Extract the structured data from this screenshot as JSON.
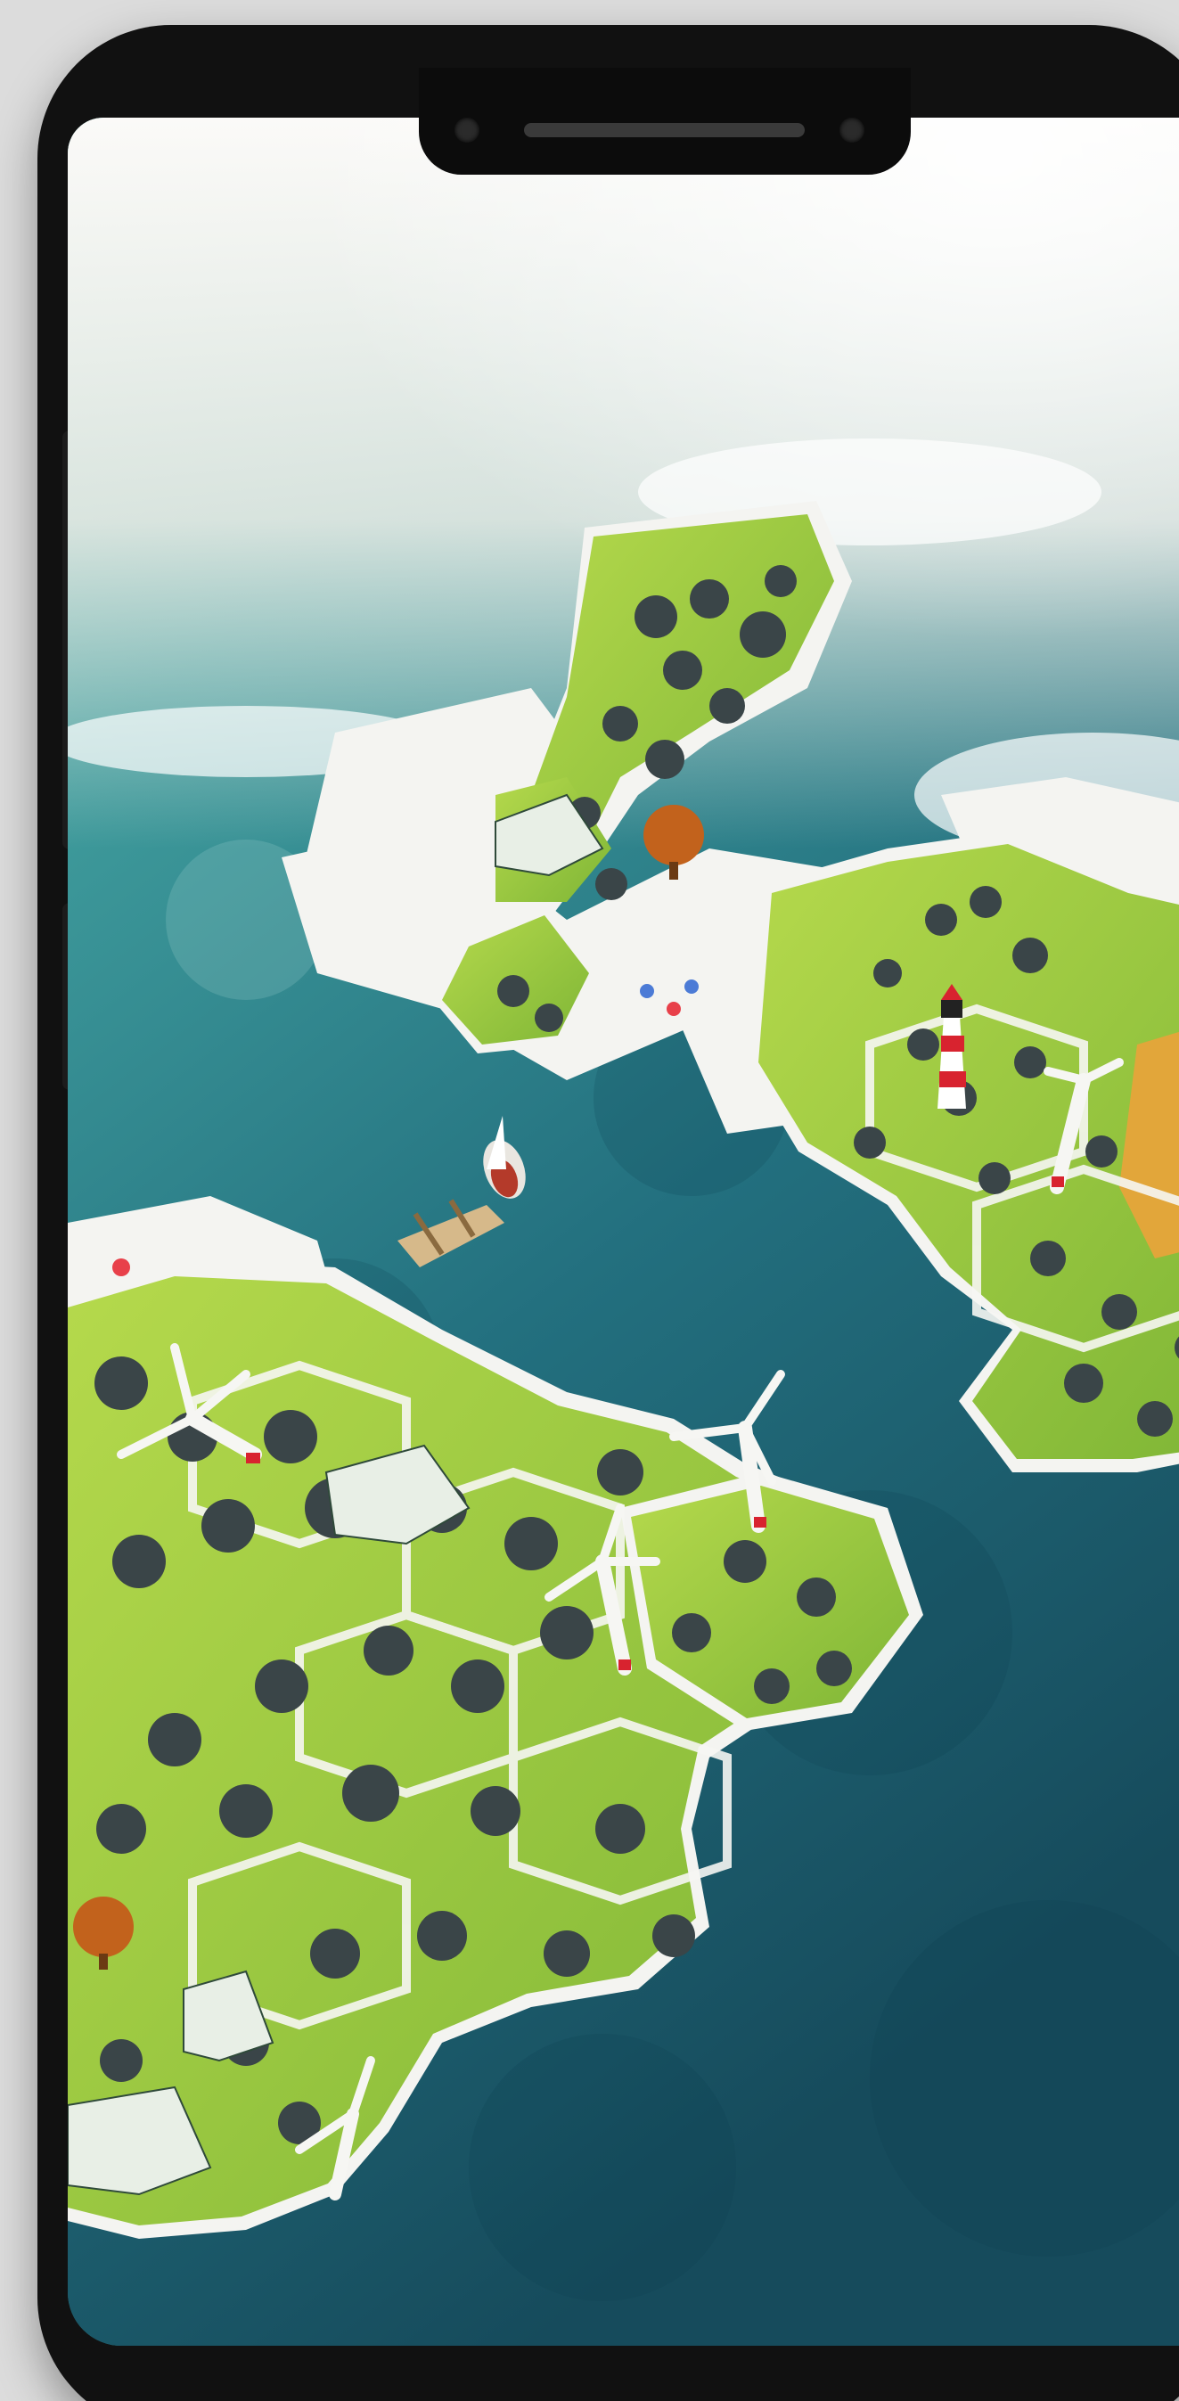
{
  "scene": {
    "description_items": [
      "island-map",
      "windmills",
      "lighthouse",
      "sailboat",
      "dock",
      "forest-tiles"
    ]
  },
  "colors": {
    "sea_deep": "#1c5a6a",
    "sea_mid": "#2f8a8f",
    "sea_light": "#5fb3ad",
    "sky_haze": "#f3f4f2",
    "grass": "#8fc23a",
    "grass_light": "#a9d44e",
    "tile_edge": "#f4f4f1",
    "tree": "#3a4548",
    "lighthouse_red": "#d8232f",
    "wheat": "#e2a63a",
    "phone_frame": "#111111",
    "background": "#dcdcdc"
  }
}
